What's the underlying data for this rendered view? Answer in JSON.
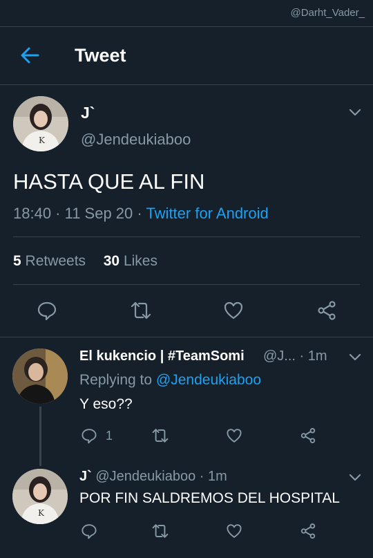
{
  "watermark": "@Darht_Vader_",
  "header": {
    "title": "Tweet"
  },
  "tweet": {
    "name": "J`",
    "handle": "@Jendeukiaboo",
    "text": "HASTA QUE AL FIN",
    "time": "18:40 · 11 Sep 20 · ",
    "source": "Twitter for Android",
    "retweets_count": "5",
    "retweets_label": " Retweets",
    "likes_count": "30",
    "likes_label": " Likes"
  },
  "replies": [
    {
      "name": "El kukencio | #TeamSomi",
      "handle_time": "@J...  · 1m",
      "replying_prefix": "Replying to ",
      "replying_to": "@Jendeukiaboo",
      "text": "Y eso??",
      "reply_count": "1"
    },
    {
      "name": "J`",
      "handle_time": " @Jendeukiaboo · 1m",
      "text": "POR FIN SALDREMOS DEL HOSPITAL"
    }
  ],
  "colors": {
    "background": "#15202b",
    "accent": "#1da1f2",
    "secondary_text": "#8899a6",
    "divider": "#38444d"
  },
  "icons": [
    "back-arrow-icon",
    "chevron-down-icon",
    "reply-icon",
    "retweet-icon",
    "like-icon",
    "share-icon"
  ]
}
